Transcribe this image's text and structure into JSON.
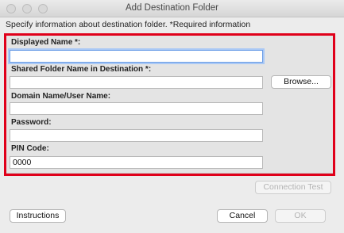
{
  "window": {
    "title": "Add Destination Folder"
  },
  "instruction": "Specify information about destination folder. *Required information",
  "form": {
    "displayed_name_label": "Displayed Name *:",
    "displayed_name_value": "",
    "shared_folder_label": "Shared Folder Name in Destination *:",
    "shared_folder_value": "",
    "browse_label": "Browse...",
    "domain_user_label": "Domain Name/User Name:",
    "domain_user_value": "",
    "password_label": "Password:",
    "password_value": "",
    "pin_label": "PIN Code:",
    "pin_value": "0000"
  },
  "buttons": {
    "connection_test": "Connection Test",
    "instructions": "Instructions",
    "cancel": "Cancel",
    "ok": "OK"
  },
  "colors": {
    "highlight": "#e0001a",
    "focus_ring": "#6c9ee6"
  }
}
